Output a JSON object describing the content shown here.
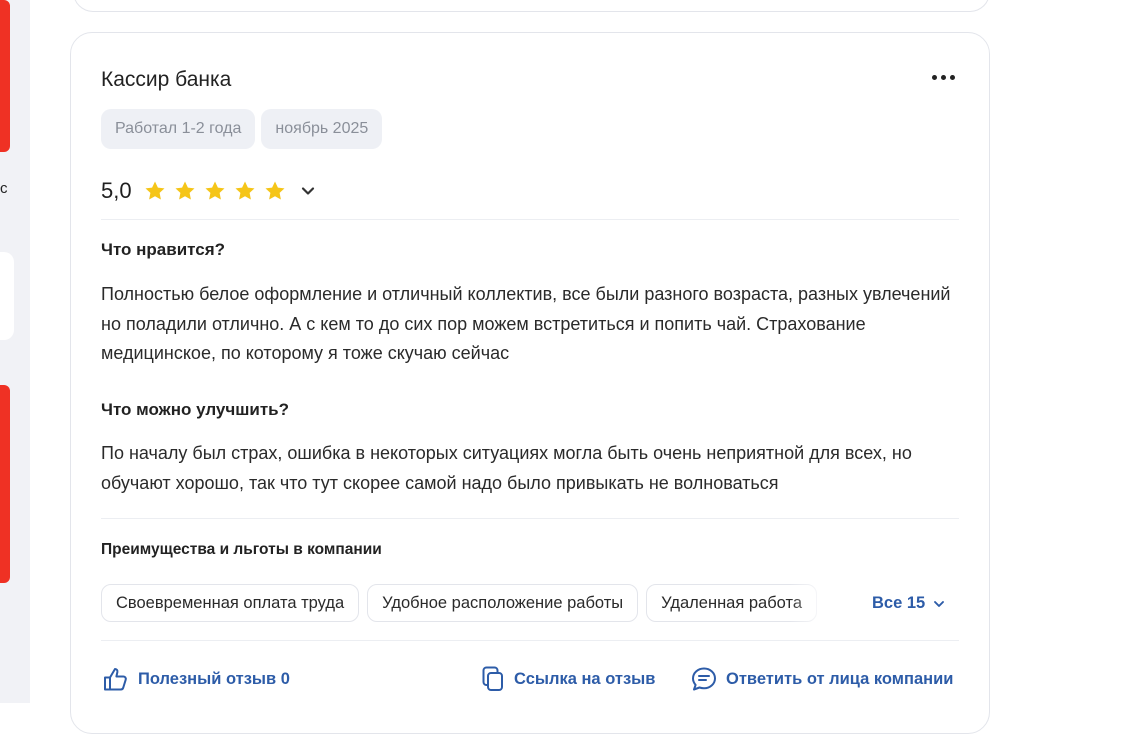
{
  "review": {
    "position_title": "Кассир банка",
    "tags": [
      "Работал 1-2 года",
      "ноябрь 2025"
    ],
    "rating_value": "5,0",
    "rating_stars": 5,
    "likes_heading": "Что нравится?",
    "likes_text": "Полностью белое оформление и отличный коллектив, все были разного возраста, разных увлечений но поладили отлично. А с кем то до сих пор можем встретиться и попить чай. Страхование медицинское, по которому я тоже скучаю сейчас",
    "improve_heading": "Что можно улучшить?",
    "improve_text": "По началу был страх, ошибка в некоторых ситуациях могла быть очень неприятной для всех, но обучают хорошо, так что тут скорее самой надо было привыкать не волноваться",
    "benefits_heading": "Преимущества и льготы в компании",
    "benefits": [
      "Своевременная оплата труда",
      "Удобное расположение работы",
      "Удаленная работа"
    ],
    "benefits_all_label": "Все 15",
    "actions": {
      "helpful_label": "Полезный отзыв 0",
      "link_label": "Ссылка на отзыв",
      "reply_label": "Ответить от лица компании"
    }
  },
  "sidebar": {
    "clipped_glyph": "с"
  },
  "colors": {
    "accent": "#2d5ca8",
    "star": "#f5c518",
    "brand_red": "#ef3124"
  },
  "icons": [
    "more-dots-icon",
    "star-icon",
    "chevron-down-icon",
    "thumbs-up-icon",
    "copy-link-icon",
    "chat-bubble-icon"
  ]
}
